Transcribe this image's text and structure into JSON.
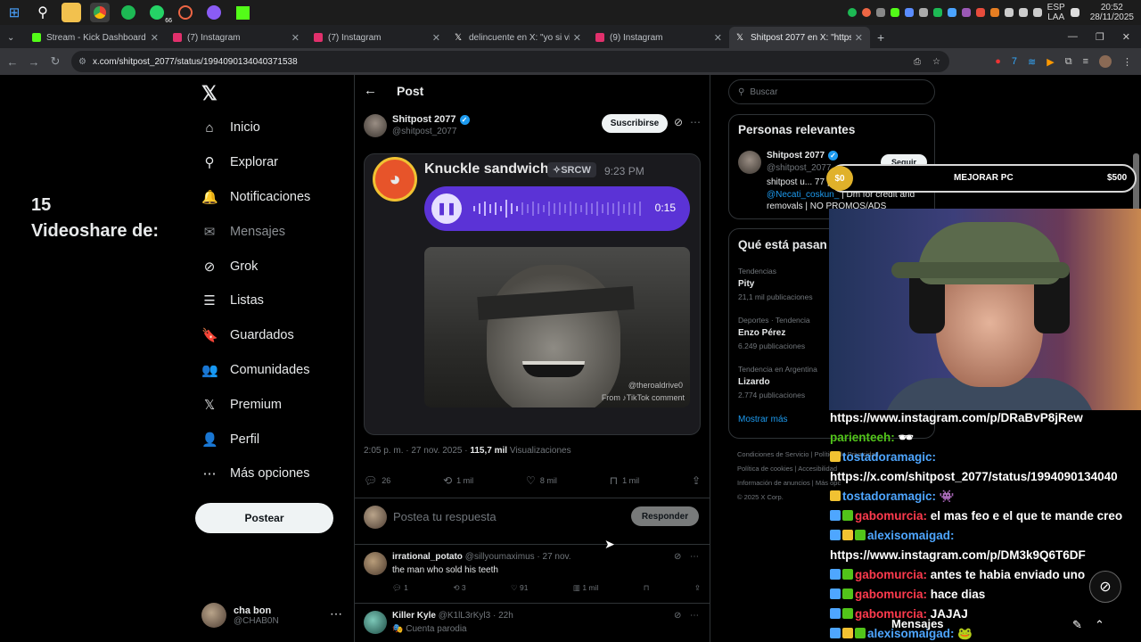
{
  "taskbar": {
    "icons": [
      "windows-icon",
      "search-icon",
      "file-explorer-icon",
      "chrome-icon",
      "spotify-icon",
      "whatsapp-icon",
      "app-icon",
      "discord-icon",
      "kick-icon"
    ],
    "whatsapp_badge": "66",
    "lang_top": "ESP",
    "lang_bottom": "LAA",
    "time": "20:52",
    "date": "28/11/2025"
  },
  "browser": {
    "tabs": [
      {
        "title": "Stream - Kick Dashboard",
        "color": "#53fc18"
      },
      {
        "title": "(7) Instagram",
        "color": "#e1306c"
      },
      {
        "title": "(7) Instagram",
        "color": "#e1306c"
      },
      {
        "title": "delincuente en X: \"yo si viene v",
        "color": "#ffffff"
      },
      {
        "title": "(9) Instagram",
        "color": "#e1306c"
      },
      {
        "title": "Shitpost 2077 en X: \"https:/",
        "color": "#ffffff"
      }
    ],
    "new_tab": "+",
    "url": "x.com/shitpost_2077/status/1994090134040371538"
  },
  "overlay_left": {
    "line1": "15",
    "line2": "Videoshare de:"
  },
  "sidebar": {
    "logo": "𝕏",
    "items": [
      {
        "label": "Inicio",
        "icon": "⌂"
      },
      {
        "label": "Explorar",
        "icon": "⚲"
      },
      {
        "label": "Notificaciones",
        "icon": "🔔"
      },
      {
        "label": "Mensajes",
        "icon": "✉"
      },
      {
        "label": "Grok",
        "icon": "⊘"
      },
      {
        "label": "Listas",
        "icon": "☰"
      },
      {
        "label": "Guardados",
        "icon": "🔖"
      },
      {
        "label": "Comunidades",
        "icon": "👥"
      },
      {
        "label": "Premium",
        "icon": "𝕏"
      },
      {
        "label": "Perfil",
        "icon": "👤"
      },
      {
        "label": "Más opciones",
        "icon": "⋯"
      }
    ],
    "post_button": "Postear",
    "profile_name": "cha bon",
    "profile_handle": "@CHAB0N"
  },
  "post": {
    "header": "Post",
    "author": "Shitpost 2077",
    "handle": "@shitpost_2077",
    "subscribe": "Suscribirse",
    "media": {
      "audio_name": "Knuckle sandwich",
      "tag": "✧SRCW",
      "time": "9:23 PM",
      "duration": "0:15",
      "watermark1": "@theroaldrive0",
      "watermark2": "From ♪TikTok comment"
    },
    "timestamp": "2:05 p. m. · 27 nov. 2025 ·",
    "views_count": "115,7 mil",
    "views_label": "Visualizaciones",
    "actions": {
      "replies": "26",
      "reposts": "1 mil",
      "likes": "8 mil",
      "bookmarks": "1 mil"
    },
    "reply_placeholder": "Postea tu respuesta",
    "reply_button": "Responder"
  },
  "replies": [
    {
      "name": "irrational_potato",
      "meta": "@sillyoumaximus · 27 nov.",
      "text": "the man who sold his teeth",
      "replies": "1",
      "reposts": "3",
      "likes": "91",
      "views": "1 mil"
    },
    {
      "name": "Killer Kyle",
      "meta": "@K1lL3rKyl3 · 22h",
      "text": "🎭 Cuenta parodia"
    }
  ],
  "right": {
    "search_placeholder": "Buscar",
    "relevant_title": "Personas relevantes",
    "rel_name": "Shitpost 2077",
    "rel_handle": "@shitpost_2077",
    "rel_bio_1": "shitpost u... 77 | owner",
    "rel_mention": "@Necati_coskun_",
    "rel_bio_2": "| Dm for credit and removals | NO PROMOS/ADS",
    "follow": "Seguir",
    "trends_title": "Qué está pasan",
    "trends": [
      {
        "context": "Tendencias",
        "name": "Pity",
        "posts": "21,1 mil publicaciones"
      },
      {
        "context": "Deportes · Tendencia",
        "name": "Enzo Pérez",
        "posts": "6.249 publicaciones"
      },
      {
        "context": "Tendencia en Argentina",
        "name": "Lizardo",
        "posts": "2.774 publicaciones"
      }
    ],
    "show_more": "Mostrar más",
    "footer": [
      "Condiciones de Servicio",
      "Política de Privacidad",
      "Política de cookies",
      "Accesibilidad",
      "Información de anuncios",
      "Más opc",
      "© 2025 X Corp."
    ]
  },
  "stream": {
    "goal_current": "$0",
    "goal_label": "MEJORAR PC",
    "goal_target": "$500",
    "chat": [
      {
        "user": "",
        "text": "https://www.instagram.com/p/DRaBvP8jRew",
        "user_color": "#ffffff"
      },
      {
        "user": "parienteeh:",
        "text": "🕶",
        "user_color": "#52c41a"
      },
      {
        "user": "tostadoramagic:",
        "text": "",
        "user_color": "#4ea6ff"
      },
      {
        "user": "",
        "text": "https://x.com/shitpost_2077/status/1994090134040",
        "user_color": "#ffffff"
      },
      {
        "user": "tostadoramagic:",
        "text": "👾",
        "user_color": "#4ea6ff"
      },
      {
        "user": "gabomurcia:",
        "text": "el mas feo e el que te mande creo",
        "user_color": "#ff3b4e"
      },
      {
        "user": "alexisomaigad:",
        "text": "",
        "user_color": "#4ea6ff"
      },
      {
        "user": "",
        "text": "https://www.instagram.com/p/DM3k9Q6T6DF",
        "user_color": "#ffffff"
      },
      {
        "user": "gabomurcia:",
        "text": "antes te habia enviado uno",
        "user_color": "#ff3b4e"
      },
      {
        "user": "gabomurcia:",
        "text": "hace dias",
        "user_color": "#ff3b4e"
      },
      {
        "user": "gabomurcia:",
        "text": "JAJAJ",
        "user_color": "#ff3b4e"
      },
      {
        "user": "alexisomaigad:",
        "text": "🐸",
        "user_color": "#4ea6ff"
      }
    ],
    "chat_mode": "Mensajes"
  }
}
